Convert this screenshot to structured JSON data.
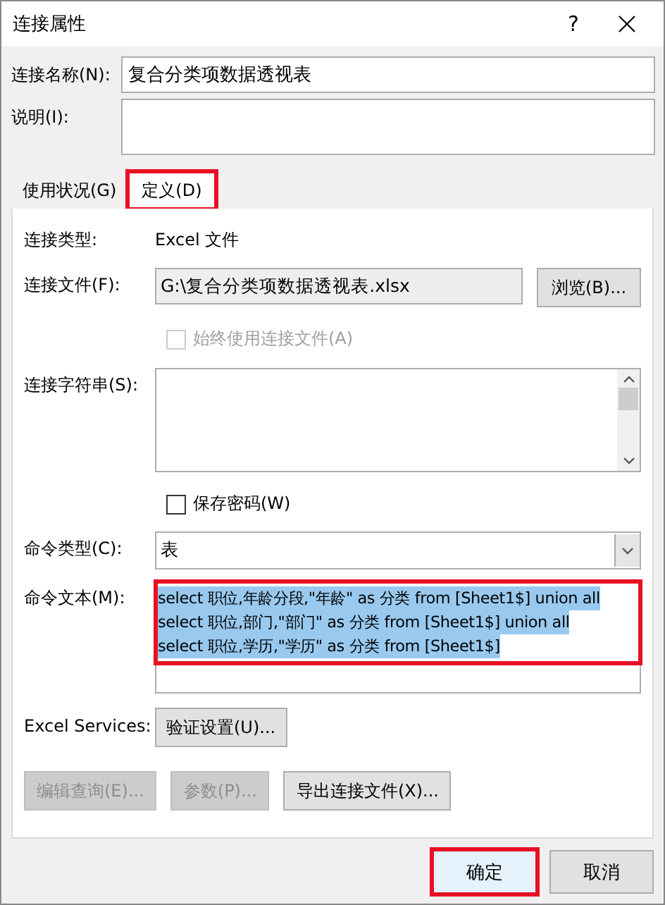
{
  "window": {
    "title": "连接属性",
    "help": "?"
  },
  "connection_name": {
    "label": "连接名称(N):",
    "value": "复合分类项数据透视表"
  },
  "description": {
    "label": "说明(I):"
  },
  "tabs": [
    {
      "label": "使用状况(G)",
      "selected": false,
      "highlighted": false
    },
    {
      "label": "定义(D)",
      "selected": true,
      "highlighted": true
    }
  ],
  "definition": {
    "connection_type": {
      "label": "连接类型:",
      "value": "Excel 文件"
    },
    "connection_file": {
      "label": "连接文件(F):",
      "value": "G:\\复合分类项数据透视表.xlsx",
      "button": "浏览(B)..."
    },
    "always_use_file": {
      "label": "始终使用连接文件(A)",
      "checked": false,
      "disabled": true
    },
    "connection_string": {
      "label": "连接字符串(S):"
    },
    "save_password": {
      "label": "保存密码(W)",
      "checked": false,
      "disabled": false
    },
    "command_type": {
      "label": "命令类型(C):",
      "value": "表"
    },
    "command_text": {
      "label": "命令文本(M):",
      "selected": true,
      "highlighted": true,
      "lines": [
        "select 职位,年龄分段,\"年龄\" as 分类 from [Sheet1$] union all",
        "select 职位,部门,\"部门\" as 分类 from [Sheet1$] union all",
        "select 职位,学历,\"学历\" as 分类 from [Sheet1$]"
      ]
    },
    "excel_services": {
      "label": "Excel Services:",
      "button": "验证设置(U)..."
    },
    "action_buttons": [
      {
        "label": "编辑查询(E)...",
        "disabled": true
      },
      {
        "label": "参数(P)...",
        "disabled": true
      },
      {
        "label": "导出连接文件(X)...",
        "disabled": false
      }
    ]
  },
  "buttons": [
    {
      "label": "确定",
      "default": true,
      "highlighted": true
    },
    {
      "label": "取消",
      "default": false,
      "highlighted": false
    }
  ]
}
